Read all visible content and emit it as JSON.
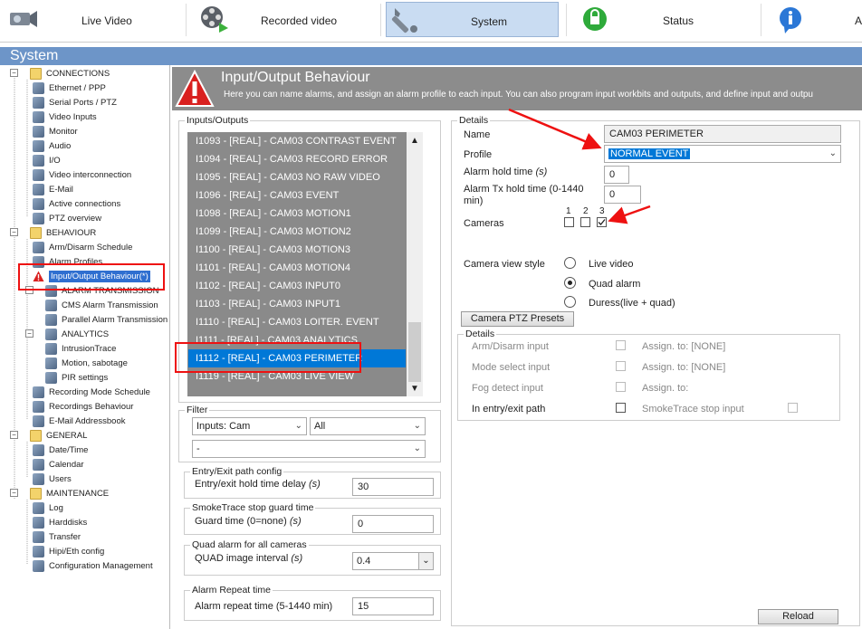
{
  "nav": {
    "tabs": [
      {
        "label": "Live Video",
        "icon": "camera-icon"
      },
      {
        "label": "Recorded video",
        "icon": "film-reel-icon"
      },
      {
        "label": "System",
        "icon": "wrench-icon"
      },
      {
        "label": "Status",
        "icon": "status-icon"
      },
      {
        "label": "A",
        "icon": "info-icon"
      }
    ],
    "active": "System"
  },
  "system_bar": {
    "title": "System"
  },
  "sidebar": {
    "items": [
      {
        "label": "CONNECTIONS",
        "type": "category",
        "icon": "folder-icon"
      },
      {
        "label": "Ethernet / PPP",
        "icon": "ethernet-icon"
      },
      {
        "label": "Serial Ports / PTZ",
        "icon": "serial-port-icon"
      },
      {
        "label": "Video Inputs",
        "icon": "video-input-icon"
      },
      {
        "label": "Monitor",
        "icon": "monitor-icon"
      },
      {
        "label": "Audio",
        "icon": "headphones-icon"
      },
      {
        "label": "I/O",
        "icon": "io-icon"
      },
      {
        "label": "Video interconnection",
        "icon": "interconnect-icon"
      },
      {
        "label": "E-Mail",
        "icon": "email-icon"
      },
      {
        "label": "Active connections",
        "icon": "connections-icon"
      },
      {
        "label": "PTZ overview",
        "icon": "ptz-icon"
      },
      {
        "label": "BEHAVIOUR",
        "type": "category",
        "icon": "folder-icon"
      },
      {
        "label": "Arm/Disarm Schedule",
        "icon": "schedule-icon"
      },
      {
        "label": "Alarm Profiles",
        "icon": "alarm-profile-icon"
      },
      {
        "label": "Input/Output Behaviour(*)",
        "icon": "warning-icon",
        "selected": true
      },
      {
        "label": "ALARM TRANSMISSION",
        "type": "subcategory",
        "icon": "transmission-icon"
      },
      {
        "label": "CMS Alarm Transmission",
        "icon": "cms-icon"
      },
      {
        "label": "Parallel Alarm Transmission",
        "icon": "parallel-icon"
      },
      {
        "label": "ANALYTICS",
        "type": "subcategory",
        "icon": "analytics-icon"
      },
      {
        "label": "IntrusionTrace",
        "icon": "intrusion-icon"
      },
      {
        "label": "Motion, sabotage",
        "icon": "motion-icon"
      },
      {
        "label": "PIR settings",
        "icon": "pir-icon"
      },
      {
        "label": "Recording Mode Schedule",
        "icon": "calendar-icon"
      },
      {
        "label": "Recordings Behaviour",
        "icon": "recording-icon"
      },
      {
        "label": "E-Mail Addressbook",
        "icon": "addressbook-icon"
      },
      {
        "label": "GENERAL",
        "type": "category",
        "icon": "folder-icon"
      },
      {
        "label": "Date/Time",
        "icon": "clock-icon"
      },
      {
        "label": "Calendar",
        "icon": "calendar-icon"
      },
      {
        "label": "Users",
        "icon": "users-icon"
      },
      {
        "label": "MAINTENANCE",
        "type": "category",
        "icon": "folder-icon"
      },
      {
        "label": "Log",
        "icon": "log-icon"
      },
      {
        "label": "Harddisks",
        "icon": "harddisk-icon"
      },
      {
        "label": "Transfer",
        "icon": "transfer-icon"
      },
      {
        "label": "Hipi/Eth config",
        "icon": "network-config-icon"
      },
      {
        "label": "Configuration Management",
        "icon": "config-icon"
      }
    ]
  },
  "header": {
    "title": "Input/Output Behaviour",
    "description": "Here you can name alarms, and assign an alarm profile to each input. You can also program input workbits and outputs, and define input and outpu"
  },
  "io_panel": {
    "legend": "Inputs/Outputs",
    "items": [
      "I1093 - [REAL] - CAM03 CONTRAST EVENT",
      "I1094 - [REAL] - CAM03 RECORD ERROR",
      "I1095 - [REAL] - CAM03 NO RAW VIDEO",
      "I1096 - [REAL] - CAM03 EVENT",
      "I1098 - [REAL] - CAM03 MOTION1",
      "I1099 - [REAL] - CAM03 MOTION2",
      "I1100 - [REAL] - CAM03 MOTION3",
      "I1101 - [REAL] - CAM03 MOTION4",
      "I1102 - [REAL] - CAM03 INPUT0",
      "I1103 - [REAL] - CAM03 INPUT1",
      "I1110 - [REAL] - CAM03 LOITER. EVENT",
      "I1111 - [REAL] - CAM03 ANALYTICS",
      "I1112 - [REAL] - CAM03 PERIMETER",
      "I1119 - [REAL] - CAM03 LIVE VIEW"
    ],
    "selected_index": 12
  },
  "filter": {
    "legend": "Filter",
    "type_value": "Inputs: Cam",
    "state_value": "All",
    "sub_value": "-"
  },
  "entry_exit": {
    "legend": "Entry/Exit path config",
    "label": "Entry/exit hold time delay",
    "unit": "(s)",
    "value": "30"
  },
  "smoketrace": {
    "legend": "SmokeTrace stop guard time",
    "label": "Guard time (0=none)",
    "unit": "(s)",
    "value": "0"
  },
  "quad": {
    "legend": "Quad alarm for all cameras",
    "label": "QUAD image interval",
    "unit": "(s)",
    "value": "0.4"
  },
  "repeat": {
    "legend": "Alarm Repeat time",
    "label": "Alarm repeat time (5-1440 min)",
    "value": "15"
  },
  "details": {
    "legend": "Details",
    "name_label": "Name",
    "name_value": "CAM03 PERIMETER",
    "profile_label": "Profile",
    "profile_value": "NORMAL EVENT",
    "hold_label": "Alarm hold time",
    "hold_unit": "(s)",
    "hold_value": "0",
    "tx_label_1": "Alarm Tx hold time (0-1440",
    "tx_label_2": "min)",
    "tx_value": "0",
    "cameras_label": "Cameras",
    "camera_numbers": [
      "1",
      "2",
      "3"
    ],
    "camera_checked": [
      false,
      false,
      true
    ],
    "view_style_label": "Camera view style",
    "view_options": [
      "Live video",
      "Quad alarm",
      "Duress(live + quad)"
    ],
    "view_selected": 1,
    "ptz_button": "Camera PTZ Presets"
  },
  "sub_details": {
    "legend": "Details",
    "rows": [
      {
        "label": "Arm/Disarm input",
        "assign": "Assign. to: [NONE]",
        "enabled": false
      },
      {
        "label": "Mode select input",
        "assign": "Assign. to: [NONE]",
        "enabled": false
      },
      {
        "label": "Fog detect input",
        "assign": "Assign. to:",
        "enabled": false
      },
      {
        "label": "In entry/exit path",
        "assign": "SmokeTrace stop input",
        "enabled": true
      }
    ]
  },
  "reload_button": "Reload",
  "colors": {
    "accent": "#0078d7",
    "highlight": "#e11111",
    "banner": "#8c8c8c",
    "system_bar": "#6d95c8"
  }
}
